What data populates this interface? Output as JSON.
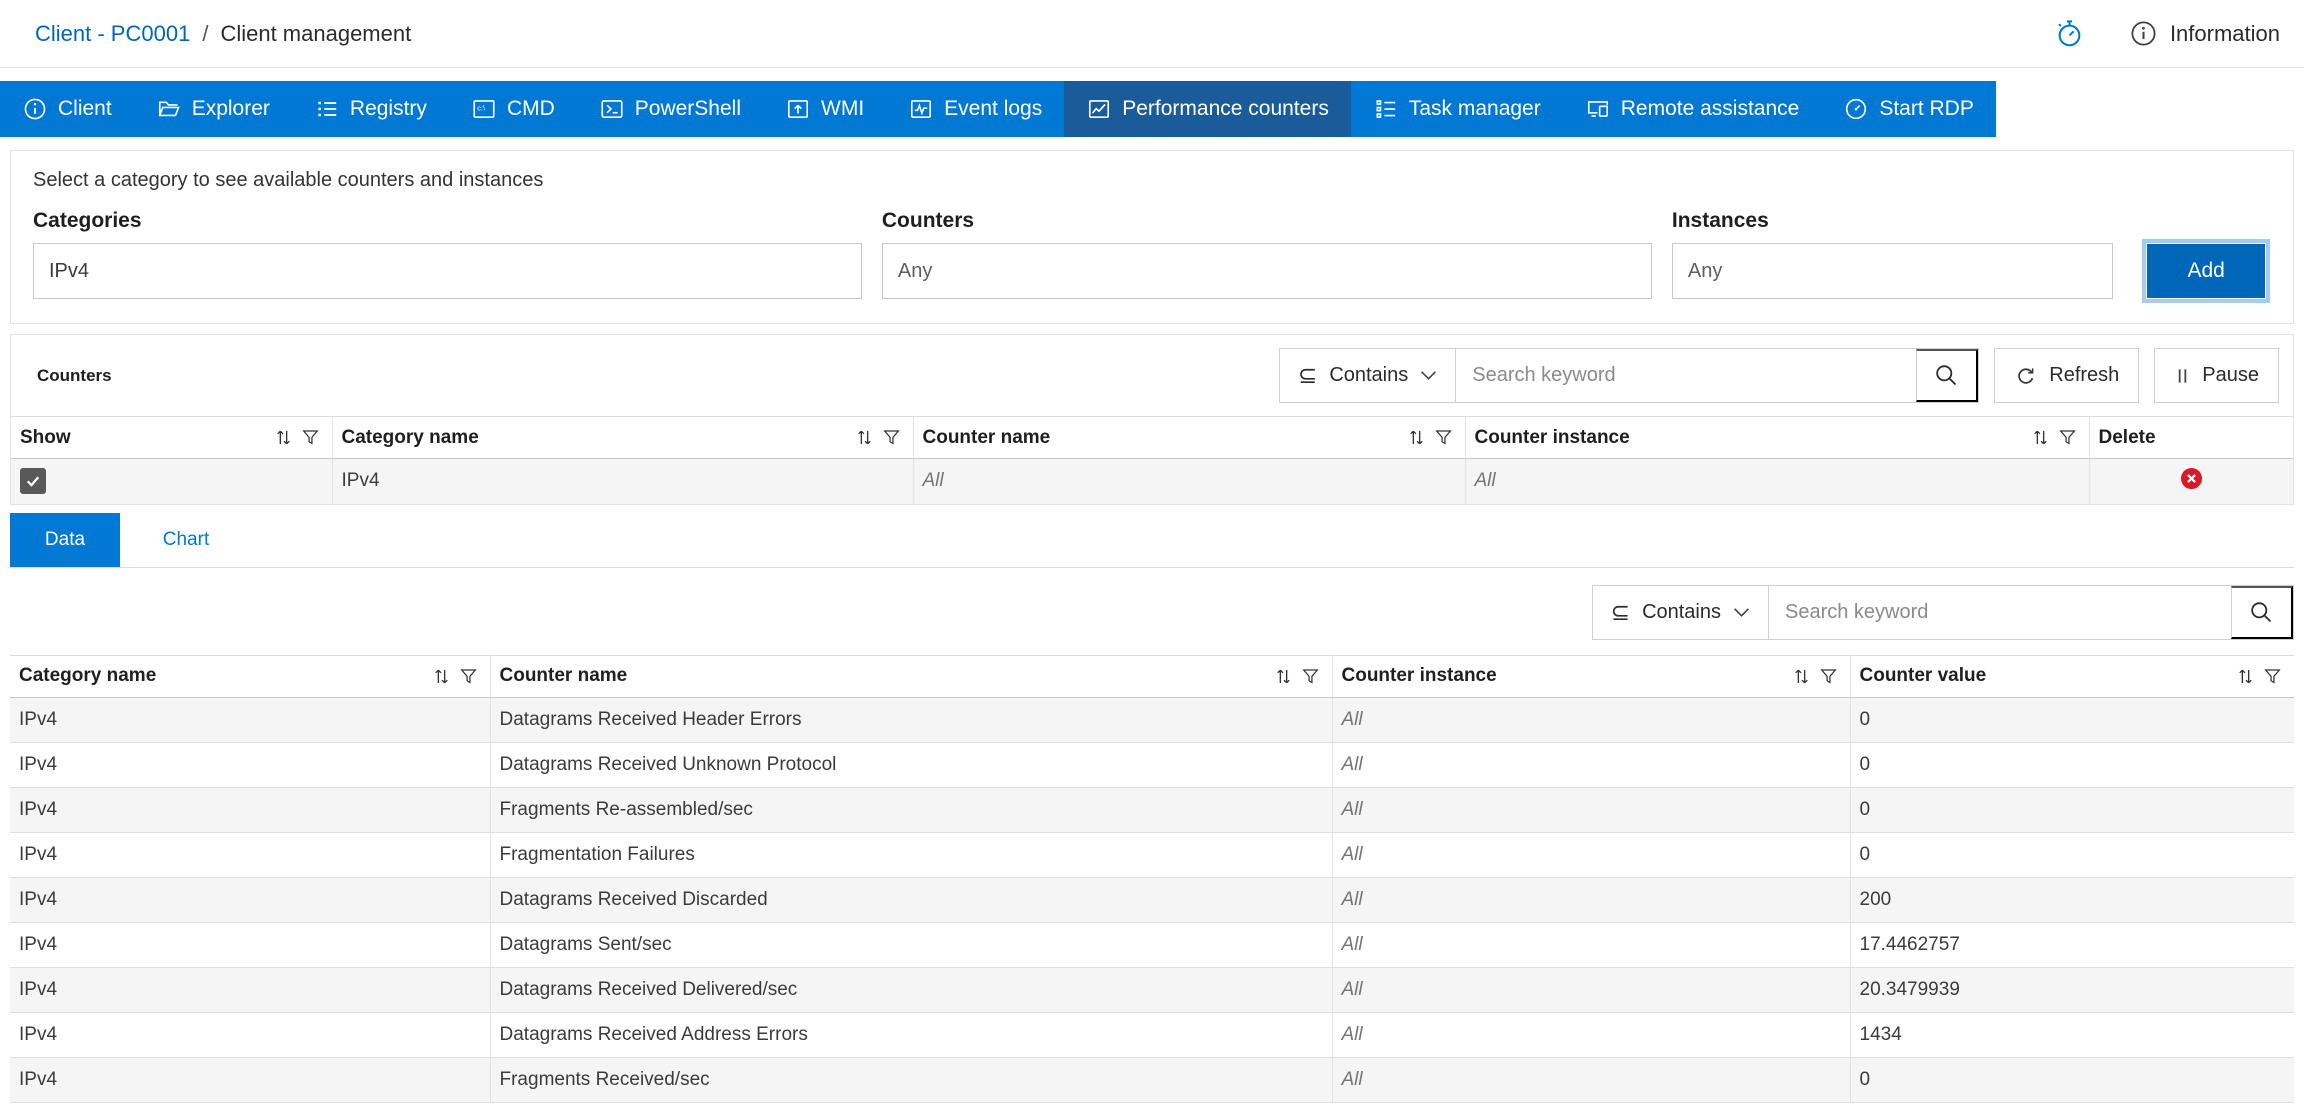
{
  "breadcrumb": {
    "link_label": "Client - PC0001",
    "separator": "/",
    "current_label": "Client management"
  },
  "topbar": {
    "information_label": "Information"
  },
  "nav": {
    "tabs": [
      {
        "label": "Client",
        "active": false
      },
      {
        "label": "Explorer",
        "active": false
      },
      {
        "label": "Registry",
        "active": false
      },
      {
        "label": "CMD",
        "active": false
      },
      {
        "label": "PowerShell",
        "active": false
      },
      {
        "label": "WMI",
        "active": false
      },
      {
        "label": "Event logs",
        "active": false
      },
      {
        "label": "Performance counters",
        "active": true
      },
      {
        "label": "Task manager",
        "active": false
      },
      {
        "label": "Remote assistance",
        "active": false
      },
      {
        "label": "Start RDP",
        "active": false
      }
    ]
  },
  "selector": {
    "hint": "Select a category to see available counters and instances",
    "categories_label": "Categories",
    "categories_value": "IPv4",
    "counters_label": "Counters",
    "counters_value": "Any",
    "instances_label": "Instances",
    "instances_value": "Any",
    "add_label": "Add"
  },
  "counters_panel": {
    "title": "Counters",
    "operator_label": "Contains",
    "search_placeholder": "Search keyword",
    "refresh_label": "Refresh",
    "pause_label": "Pause",
    "table": {
      "col_show": "Show",
      "col_category": "Category name",
      "col_counter": "Counter name",
      "col_instance": "Counter instance",
      "col_delete": "Delete",
      "row": {
        "show_checked": true,
        "category": "IPv4",
        "counter": "All",
        "instance": "All"
      }
    }
  },
  "view_tabs": {
    "data_label": "Data",
    "chart_label": "Chart",
    "active": "Data"
  },
  "data_panel": {
    "operator_label": "Contains",
    "search_placeholder": "Search keyword",
    "table": {
      "col_category": "Category name",
      "col_counter": "Counter name",
      "col_instance": "Counter instance",
      "col_value": "Counter value",
      "rows": [
        {
          "category": "IPv4",
          "counter": "Datagrams Received Header Errors",
          "instance": "All",
          "value": "0"
        },
        {
          "category": "IPv4",
          "counter": "Datagrams Received Unknown Protocol",
          "instance": "All",
          "value": "0"
        },
        {
          "category": "IPv4",
          "counter": "Fragments Re-assembled/sec",
          "instance": "All",
          "value": "0"
        },
        {
          "category": "IPv4",
          "counter": "Fragmentation Failures",
          "instance": "All",
          "value": "0"
        },
        {
          "category": "IPv4",
          "counter": "Datagrams Received Discarded",
          "instance": "All",
          "value": "200"
        },
        {
          "category": "IPv4",
          "counter": "Datagrams Sent/sec",
          "instance": "All",
          "value": "17.4462757"
        },
        {
          "category": "IPv4",
          "counter": "Datagrams Received Delivered/sec",
          "instance": "All",
          "value": "20.3479939"
        },
        {
          "category": "IPv4",
          "counter": "Datagrams Received Address Errors",
          "instance": "All",
          "value": "1434"
        },
        {
          "category": "IPv4",
          "counter": "Fragments Received/sec",
          "instance": "All",
          "value": "0"
        }
      ]
    }
  },
  "colors": {
    "accent": "#0078d4",
    "accent_selected": "#1a5c99",
    "link": "#0067b8",
    "add_button": "#0067b8",
    "delete_red": "#dc1928",
    "row_stripe": "#f5f5f5"
  }
}
